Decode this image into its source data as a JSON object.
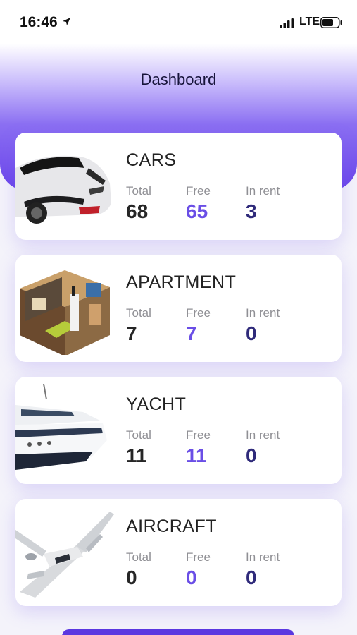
{
  "status_bar": {
    "time": "16:46",
    "network": "LTE"
  },
  "header": {
    "title": "Dashboard"
  },
  "stat_labels": {
    "total": "Total",
    "free": "Free",
    "in_rent": "In rent"
  },
  "cards": [
    {
      "title": "CARS",
      "image": "sports-car-image",
      "total": "68",
      "free": "65",
      "in_rent": "3"
    },
    {
      "title": "APARTMENT",
      "image": "apartment-image",
      "total": "7",
      "free": "7",
      "in_rent": "0"
    },
    {
      "title": "YACHT",
      "image": "yacht-image",
      "total": "11",
      "free": "11",
      "in_rent": "0"
    },
    {
      "title": "AIRCRAFT",
      "image": "private-jet-image",
      "total": "0",
      "free": "0",
      "in_rent": "0"
    }
  ],
  "colors": {
    "accent": "#6a44ea",
    "free_value": "#6a4ee6",
    "rent_value": "#2f2a7a",
    "background": "#f4f3fa"
  }
}
